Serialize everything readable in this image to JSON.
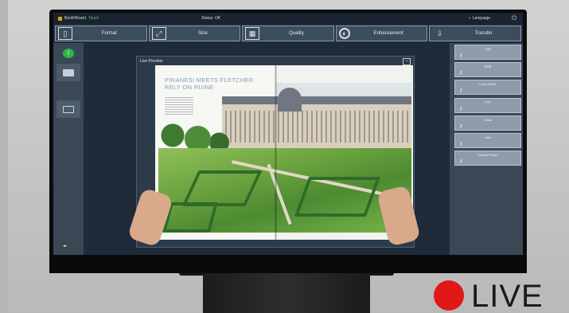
{
  "titlebar": {
    "app_name": "BookWizard",
    "app_suffix": "Touch",
    "status": "Status: OK",
    "language": "Language"
  },
  "toolbar": [
    {
      "label": "Format",
      "icon": "page-format-icon"
    },
    {
      "label": "Size",
      "icon": "resize-icon"
    },
    {
      "label": "Quality",
      "icon": "quality-icon"
    },
    {
      "label": "Enhancement",
      "icon": "contrast-icon"
    },
    {
      "label": "Transfer",
      "icon": "download-icon"
    }
  ],
  "preview": {
    "title": "Live Preview",
    "magazine_headline": "PIRANESI MEETS FLETCHER\nRELY ON RUINE"
  },
  "destinations": [
    {
      "label": "USB"
    },
    {
      "label": "SMB"
    },
    {
      "label": "Local Share"
    },
    {
      "label": "FTP"
    },
    {
      "label": "Cloud"
    },
    {
      "label": "Mail"
    },
    {
      "label": "Default Printer"
    }
  ],
  "overlay": {
    "live_label": "LIVE",
    "live_color": "#e01818"
  }
}
